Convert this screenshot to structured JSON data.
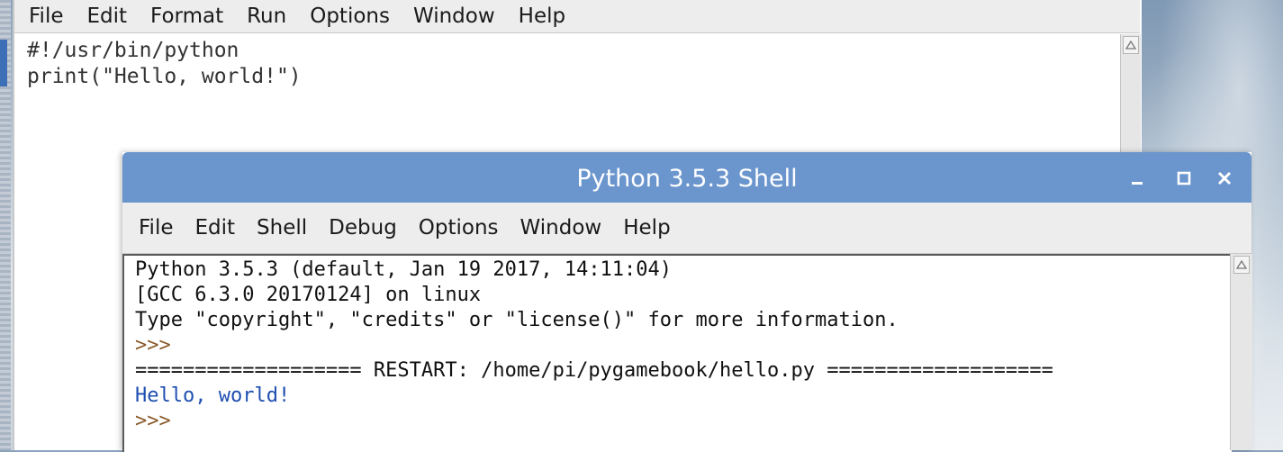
{
  "editor": {
    "menu": [
      "File",
      "Edit",
      "Format",
      "Run",
      "Options",
      "Window",
      "Help"
    ],
    "code_lines": [
      "#!/usr/bin/python",
      "print(\"Hello, world!\")"
    ]
  },
  "shell": {
    "title": "Python 3.5.3 Shell",
    "menu": [
      "File",
      "Edit",
      "Shell",
      "Debug",
      "Options",
      "Window",
      "Help"
    ],
    "lines": [
      "Python 3.5.3 (default, Jan 19 2017, 14:11:04)",
      "[GCC 6.3.0 20170124] on linux",
      "Type \"copyright\", \"credits\" or \"license()\" for more information.",
      ">>>",
      "=================== RESTART: /home/pi/pygamebook/hello.py ===================",
      "Hello, world!",
      ">>>"
    ],
    "buttons": {
      "minimize": "minimize-icon",
      "maximize": "maximize-icon",
      "close": "close-icon"
    }
  },
  "colors": {
    "titlebar": "#6a95cd",
    "output_text": "#1f4fb0"
  }
}
